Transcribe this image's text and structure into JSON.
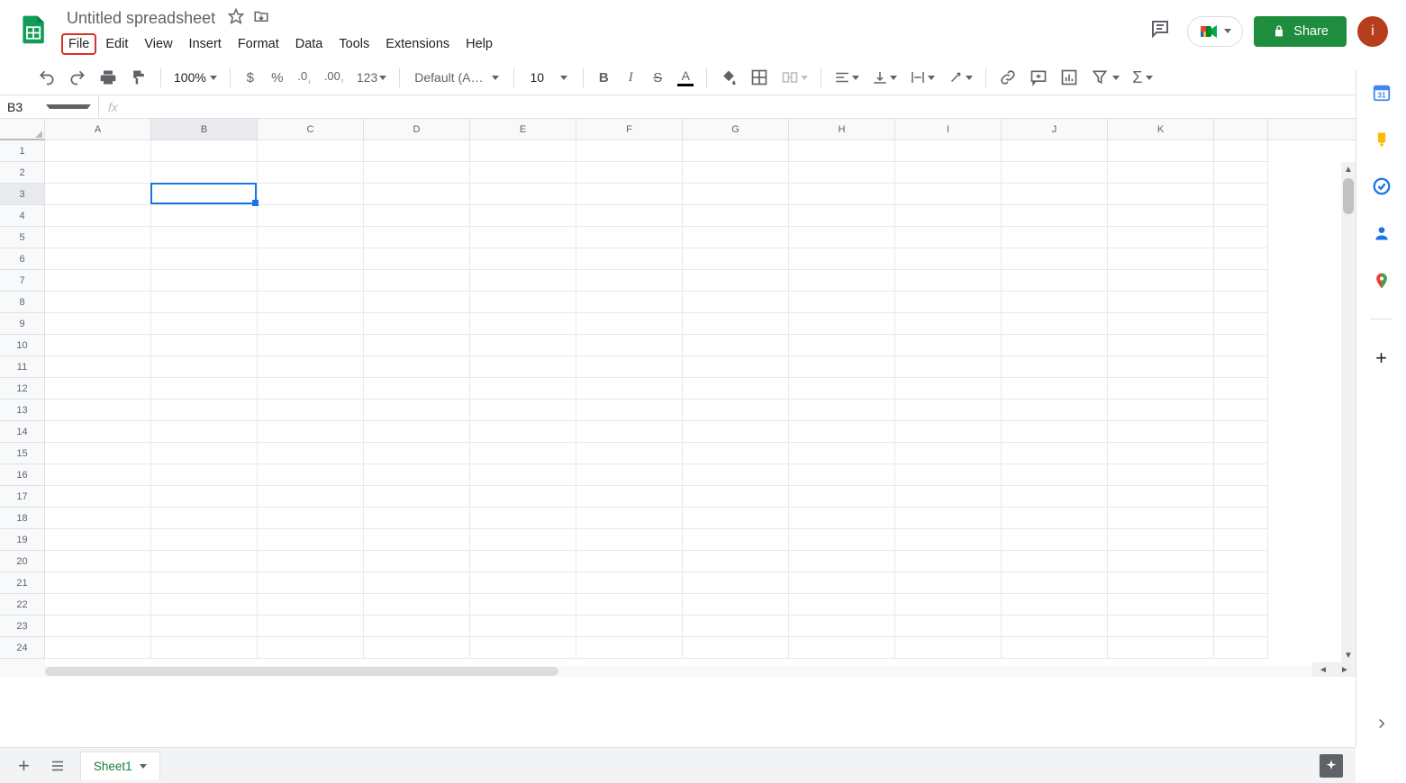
{
  "doc": {
    "title": "Untitled spreadsheet"
  },
  "menubar": [
    "File",
    "Edit",
    "View",
    "Insert",
    "Format",
    "Data",
    "Tools",
    "Extensions",
    "Help"
  ],
  "highlighted_menu_index": 0,
  "share": {
    "label": "Share"
  },
  "avatar": {
    "letter": "i"
  },
  "toolbar": {
    "zoom": "100%",
    "font_family": "Default (Ari...",
    "font_size": "10",
    "number_format_123": "123"
  },
  "name_box": "B3",
  "formula": "",
  "columns": [
    "A",
    "B",
    "C",
    "D",
    "E",
    "F",
    "G",
    "H",
    "I",
    "J",
    "K"
  ],
  "rows": [
    "1",
    "2",
    "3",
    "4",
    "5",
    "6",
    "7",
    "8",
    "9",
    "10",
    "11",
    "12",
    "13",
    "14",
    "15",
    "16",
    "17",
    "18",
    "19",
    "20",
    "21",
    "22",
    "23",
    "24"
  ],
  "selected": {
    "col_index": 1,
    "row_index": 2
  },
  "sheet_tab": {
    "name": "Sheet1"
  },
  "side_calendar_day": "31"
}
